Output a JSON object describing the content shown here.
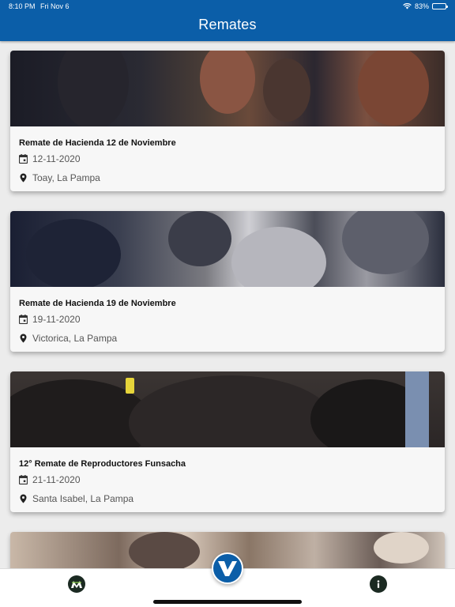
{
  "status": {
    "time": "8:10 PM",
    "date": "Fri Nov 6",
    "battery": "83%",
    "battery_level": 0.83
  },
  "header": {
    "title": "Remates"
  },
  "auctions": [
    {
      "name": "Remate de Hacienda 12 de Noviembre",
      "date": "12-11-2020",
      "location": "Toay, La Pampa"
    },
    {
      "name": "Remate de Hacienda 19 de Noviembre",
      "date": "19-11-2020",
      "location": "Victorica, La Pampa"
    },
    {
      "name": "12° Remate de Reproductores Funsacha",
      "date": "21-11-2020",
      "location": "Santa Isabel, La Pampa"
    }
  ],
  "tabs": [
    {
      "icon": "brand-m-icon"
    },
    {
      "icon": "brand-v-icon"
    },
    {
      "icon": "info-icon"
    }
  ],
  "colors": {
    "primary": "#0b5ea8",
    "tab_icon": "#1b2a22"
  }
}
